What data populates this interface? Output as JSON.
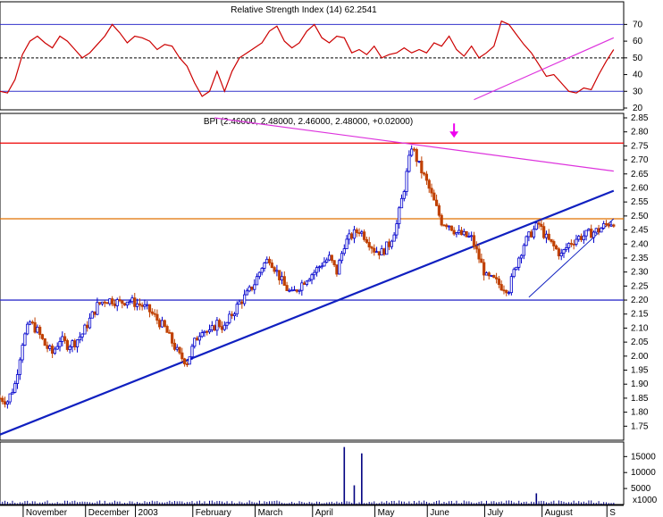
{
  "chart_data": [
    {
      "type": "line",
      "panel": "rsi",
      "title": "Relative Strength Index (14) 62.2541",
      "ylim": [
        20,
        75
      ],
      "yticks": [
        20,
        30,
        40,
        50,
        60,
        70
      ],
      "reference_levels": [
        70,
        50,
        30
      ],
      "series": [
        {
          "x": [
            0,
            3,
            6,
            9,
            12,
            15,
            18,
            21,
            24,
            27,
            30,
            33,
            36,
            39,
            42,
            45,
            48,
            51,
            54,
            57,
            60,
            63,
            66,
            69,
            72,
            75,
            78,
            81,
            84,
            87,
            90,
            93,
            96,
            99,
            102,
            105,
            108,
            111,
            114,
            117,
            120,
            123,
            126,
            129,
            132,
            135,
            138,
            141,
            144,
            147,
            150,
            153,
            156,
            159,
            162,
            165,
            168,
            171,
            174,
            177,
            180,
            183,
            186,
            189,
            192,
            195,
            198,
            201,
            204,
            207,
            210,
            213,
            216,
            219,
            222,
            225,
            228,
            231,
            234,
            237,
            240,
            243,
            246
          ],
          "y": [
            30,
            29,
            37,
            52,
            60,
            63,
            59,
            56,
            63,
            60,
            55,
            50,
            53,
            58,
            63,
            70,
            65,
            59,
            63,
            62,
            60,
            55,
            58,
            57,
            50,
            45,
            35,
            27,
            30,
            42,
            30,
            42,
            50,
            53,
            56,
            59,
            66,
            69,
            60,
            56,
            59,
            66,
            70,
            62,
            59,
            63,
            62,
            53,
            55,
            52,
            57,
            50,
            52,
            53,
            56,
            53,
            55,
            53,
            59,
            57,
            63,
            55,
            51,
            57,
            50,
            53,
            57,
            72,
            70,
            64,
            58,
            53,
            46,
            39,
            40,
            35,
            30,
            29,
            32,
            31,
            40,
            48,
            55
          ]
        }
      ],
      "trendline": {
        "x": [
          190,
          246
        ],
        "y": [
          25,
          62
        ]
      }
    },
    {
      "type": "candlestick",
      "panel": "price",
      "title": "BPI (2.46000, 2.48000, 2.46000, 2.48000, +0.02000)",
      "ylim": [
        1.7,
        2.85
      ],
      "yticks": [
        1.75,
        1.8,
        1.85,
        1.9,
        1.95,
        2.0,
        2.05,
        2.1,
        2.15,
        2.2,
        2.25,
        2.3,
        2.35,
        2.4,
        2.45,
        2.5,
        2.55,
        2.6,
        2.65,
        2.7,
        2.75,
        2.8,
        2.85
      ],
      "horizontal_levels": [
        {
          "value": 2.76,
          "color": "#ee0000"
        },
        {
          "value": 2.49,
          "color": "#e07000"
        },
        {
          "value": 2.2,
          "color": "#3333cc"
        }
      ],
      "close": {
        "x": [
          0,
          3,
          6,
          9,
          12,
          15,
          18,
          21,
          24,
          27,
          30,
          33,
          36,
          39,
          42,
          45,
          48,
          51,
          54,
          57,
          60,
          63,
          66,
          69,
          72,
          75,
          78,
          81,
          84,
          87,
          90,
          93,
          96,
          99,
          102,
          105,
          108,
          111,
          114,
          117,
          120,
          123,
          126,
          129,
          132,
          135,
          138,
          141,
          144,
          147,
          150,
          153,
          156,
          159,
          162,
          165,
          168,
          171,
          174,
          177,
          180,
          183,
          186,
          189,
          192,
          195,
          198,
          201,
          204,
          207,
          210,
          213,
          216,
          219,
          222,
          225,
          228,
          231,
          234,
          237,
          240,
          243,
          246
        ],
        "y": [
          1.85,
          1.84,
          1.9,
          2.05,
          2.12,
          2.09,
          2.04,
          2.01,
          2.06,
          2.04,
          2.05,
          2.08,
          2.13,
          2.18,
          2.2,
          2.2,
          2.19,
          2.2,
          2.19,
          2.18,
          2.16,
          2.13,
          2.1,
          2.05,
          2.0,
          1.98,
          2.05,
          2.1,
          2.08,
          2.12,
          2.1,
          2.15,
          2.19,
          2.22,
          2.26,
          2.32,
          2.35,
          2.3,
          2.25,
          2.22,
          2.25,
          2.28,
          2.3,
          2.33,
          2.35,
          2.3,
          2.4,
          2.43,
          2.45,
          2.42,
          2.38,
          2.37,
          2.4,
          2.47,
          2.6,
          2.75,
          2.68,
          2.62,
          2.55,
          2.48,
          2.47,
          2.44,
          2.43,
          2.42,
          2.35,
          2.28,
          2.27,
          2.25,
          2.24,
          2.33,
          2.4,
          2.44,
          2.47,
          2.42,
          2.39,
          2.36,
          2.4,
          2.42,
          2.43,
          2.44,
          2.45,
          2.47,
          2.48
        ]
      },
      "trendlines": [
        {
          "name": "support",
          "x": [
            0,
            246
          ],
          "y": [
            1.72,
            2.59
          ]
        },
        {
          "name": "resistance",
          "x": [
            86,
            246
          ],
          "y": [
            2.85,
            2.66
          ]
        },
        {
          "name": "wedge-lower",
          "x": [
            212,
            246
          ],
          "y": [
            2.21,
            2.49
          ]
        }
      ],
      "annotation": {
        "x": 182,
        "y": 2.76,
        "symbol": "arrow-down",
        "color": "#ee00ee"
      }
    },
    {
      "type": "bar",
      "panel": "volume",
      "ylim": [
        0,
        19000
      ],
      "yticks": [
        5000,
        10000,
        15000
      ],
      "unit": "x1000",
      "spikes": [
        {
          "x": 138,
          "value": 18000
        },
        {
          "x": 142,
          "value": 6000
        },
        {
          "x": 145,
          "value": 16000
        },
        {
          "x": 215,
          "value": 3500
        }
      ],
      "baseline": 800
    }
  ],
  "x_axis": {
    "range": [
      0,
      250
    ],
    "ticks": [
      {
        "x": 10,
        "label": "November"
      },
      {
        "x": 35,
        "label": "December"
      },
      {
        "x": 55,
        "label": "2003"
      },
      {
        "x": 78,
        "label": "February"
      },
      {
        "x": 103,
        "label": "March"
      },
      {
        "x": 126,
        "label": "April"
      },
      {
        "x": 151,
        "label": "May"
      },
      {
        "x": 172,
        "label": "June"
      },
      {
        "x": 195,
        "label": "July"
      },
      {
        "x": 218,
        "label": "August"
      },
      {
        "x": 244,
        "label": "S"
      }
    ]
  },
  "colors": {
    "rsi_line": "#cc0000",
    "up_candle": "#0000cc",
    "down_candle": "#c04000",
    "trend_blue": "#1020c0",
    "trend_magenta": "#dd33dd",
    "grid": "#000000",
    "volume": "#000080"
  }
}
